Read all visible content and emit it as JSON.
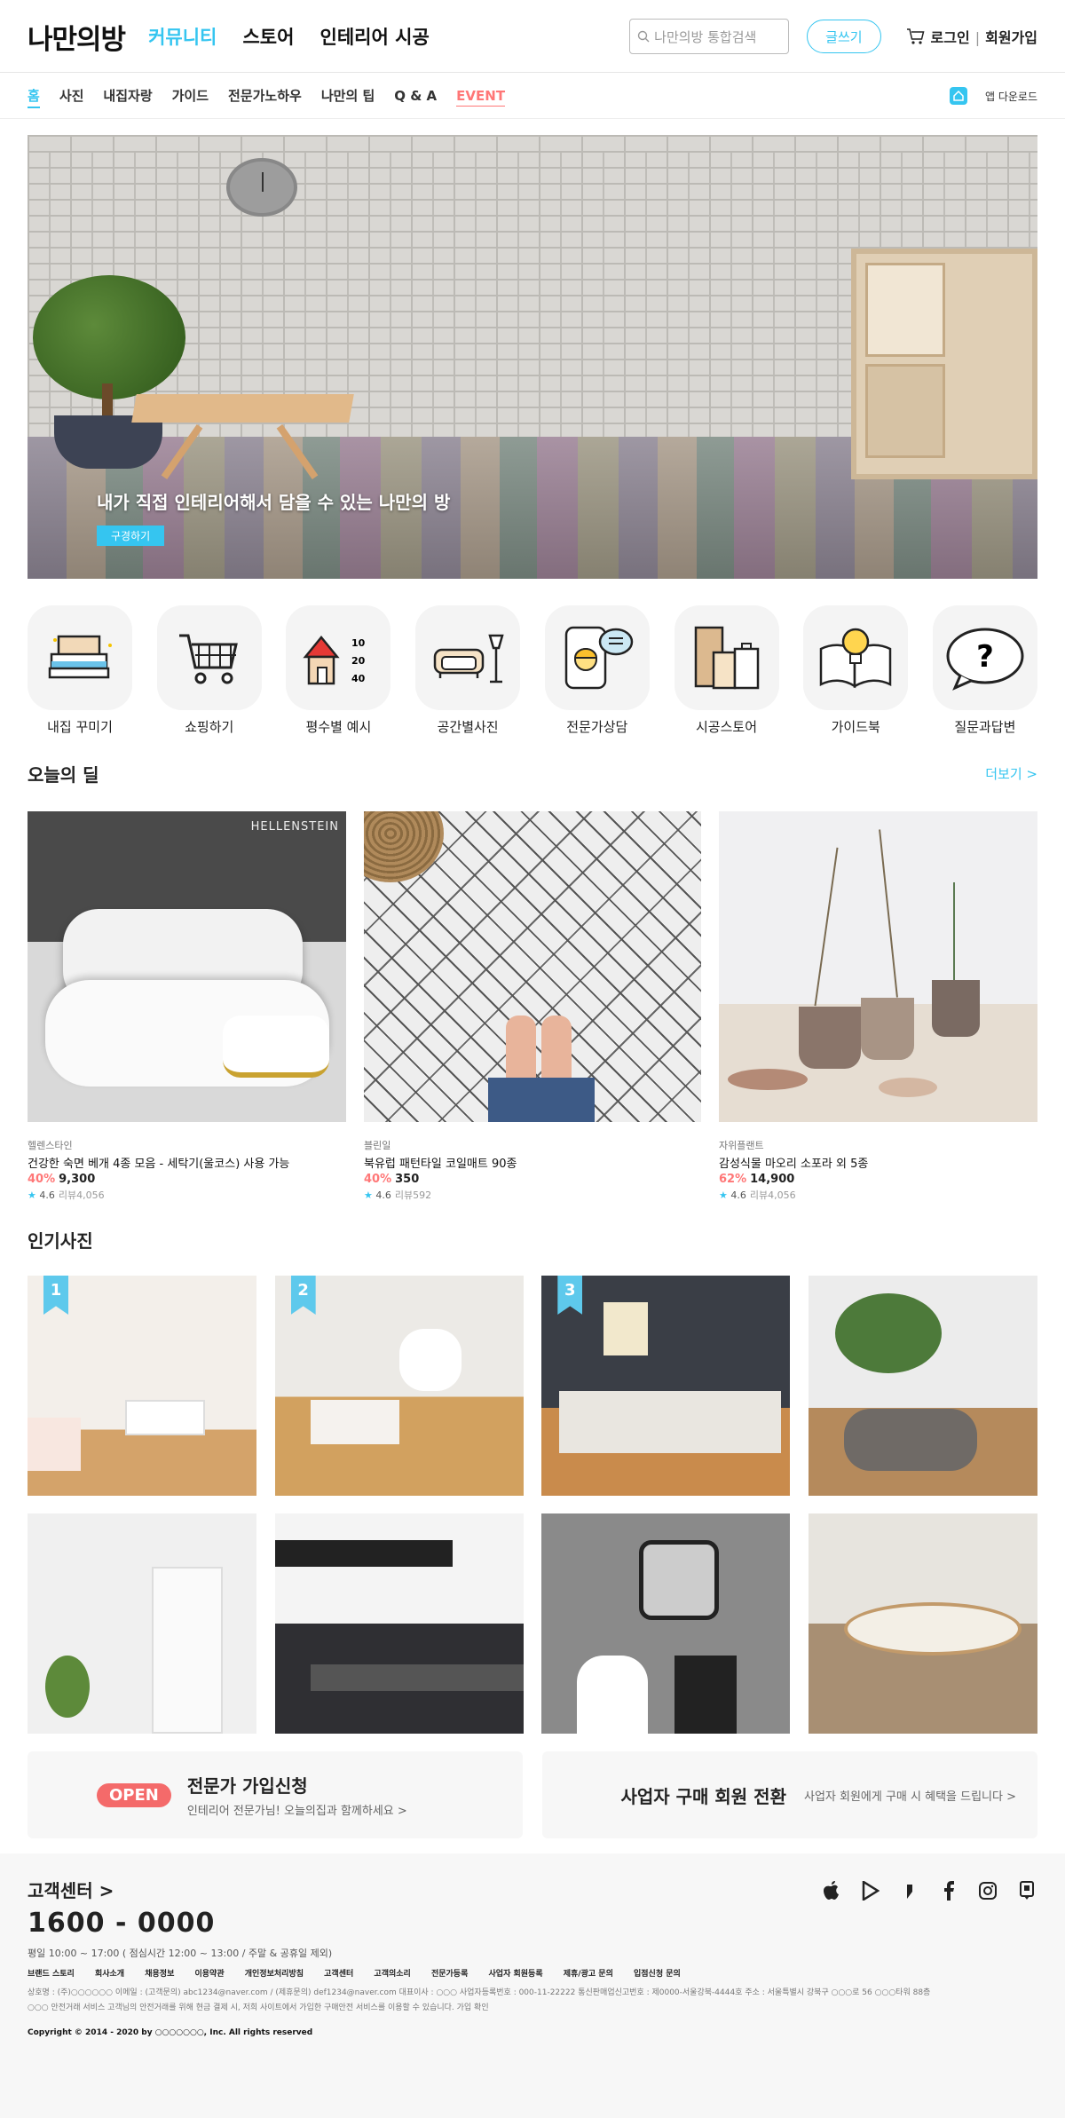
{
  "header": {
    "logo": "나만의방",
    "nav": [
      "커뮤니티",
      "스토어",
      "인테리어 시공"
    ],
    "search_placeholder": "나만의방 통합검색",
    "write_label": "글쓰기",
    "login_label": "로그인",
    "signup_label": "회원가입"
  },
  "subnav": {
    "items": [
      "홈",
      "사진",
      "내집자랑",
      "가이드",
      "전문가노하우",
      "나만의 팁",
      "Q & A",
      "EVENT"
    ],
    "app_download": "앱 다운로드"
  },
  "hero": {
    "headline": "내가 직접 인테리어해서 담을 수 있는 나만의 방",
    "button": "구경하기"
  },
  "categories": [
    {
      "label": "내집 꾸미기",
      "icon": "bed-icon"
    },
    {
      "label": "쇼핑하기",
      "icon": "cart-icon"
    },
    {
      "label": "평수별 예시",
      "icon": "house-icon",
      "sizes": [
        "10",
        "20",
        "40"
      ]
    },
    {
      "label": "공간별사진",
      "icon": "sofa-icon"
    },
    {
      "label": "전문가상담",
      "icon": "consult-icon"
    },
    {
      "label": "시공스토어",
      "icon": "door-icon"
    },
    {
      "label": "가이드북",
      "icon": "guidebook-icon"
    },
    {
      "label": "질문과답변",
      "icon": "question-icon"
    }
  ],
  "deals": {
    "title": "오늘의 딜",
    "more": "더보기 >",
    "items": [
      {
        "brand": "헬렌스타인",
        "name": "건강한 숙면 베개 4종 모음 - 세탁기(울코스) 사용 가능",
        "discount": "40%",
        "price": "9,300",
        "rating": "4.6",
        "reviews": "리뷰4,056",
        "img_label": "HELLENSTEIN"
      },
      {
        "brand": "블린일",
        "name": "북유럽 패턴타일 코일매트 90종",
        "discount": "40%",
        "price": "350",
        "rating": "4.6",
        "reviews": "리뷰592"
      },
      {
        "brand": "자위플랜트",
        "name": "감성식물 마오리 소포라 외 5종",
        "discount": "62%",
        "price": "14,900",
        "rating": "4.6",
        "reviews": "리뷰4,056"
      }
    ]
  },
  "popular": {
    "title": "인기사진",
    "ranks": [
      "1",
      "2",
      "3"
    ]
  },
  "banners": {
    "pro_badge": "OPEN",
    "pro_title": "전문가 가입신청",
    "pro_sub": "인테리어 전문가님! 오늘의집과 함께하세요 >",
    "biz_title": "사업자 구매 회원 전환",
    "biz_sub": "사업자 회원에게 구매 시 혜택을 드립니다 >"
  },
  "footer": {
    "cs": "고객센터 >",
    "tel": "1600 - 0000",
    "hours": "평일 10:00 ~ 17:00 ( 점심시간 12:00 ~ 13:00 / 주말 & 공휴일 제외)",
    "links": [
      "브랜드 스토리",
      "회사소개",
      "채용정보",
      "이용약관",
      "개인정보처리방침",
      "고객센터",
      "고객의소리",
      "전문가등록",
      "사업자 회원등록",
      "제휴/광고 문의",
      "입점신청 문의"
    ],
    "info1": "상호명 : (주)○○○○○○  이메일 : (고객문의) abc1234@naver.com / (제휴문의) def1234@naver.com  대표이사 : ○○○  사업자등록번호 : 000-11-22222  통신판매업신고번호 : 제0000-서울강북-4444호  주소 : 서울특별시 강북구 ○○○로 56 ○○○타워 88층",
    "info2": "○○○ 안전거래 서비스 고객님의 안전거래를 위해 현금 결제 시, 저희 사이트에서 가입한 구매안전 서비스를 이용할 수 있습니다. 가입 확인",
    "copyright": "Copyright © 2014 - 2020 by ○○○○○○○, Inc. All rights reserved"
  },
  "colors": {
    "accent": "#35c5f0",
    "sale": "#f77777",
    "open_badge": "#f46a6a"
  }
}
